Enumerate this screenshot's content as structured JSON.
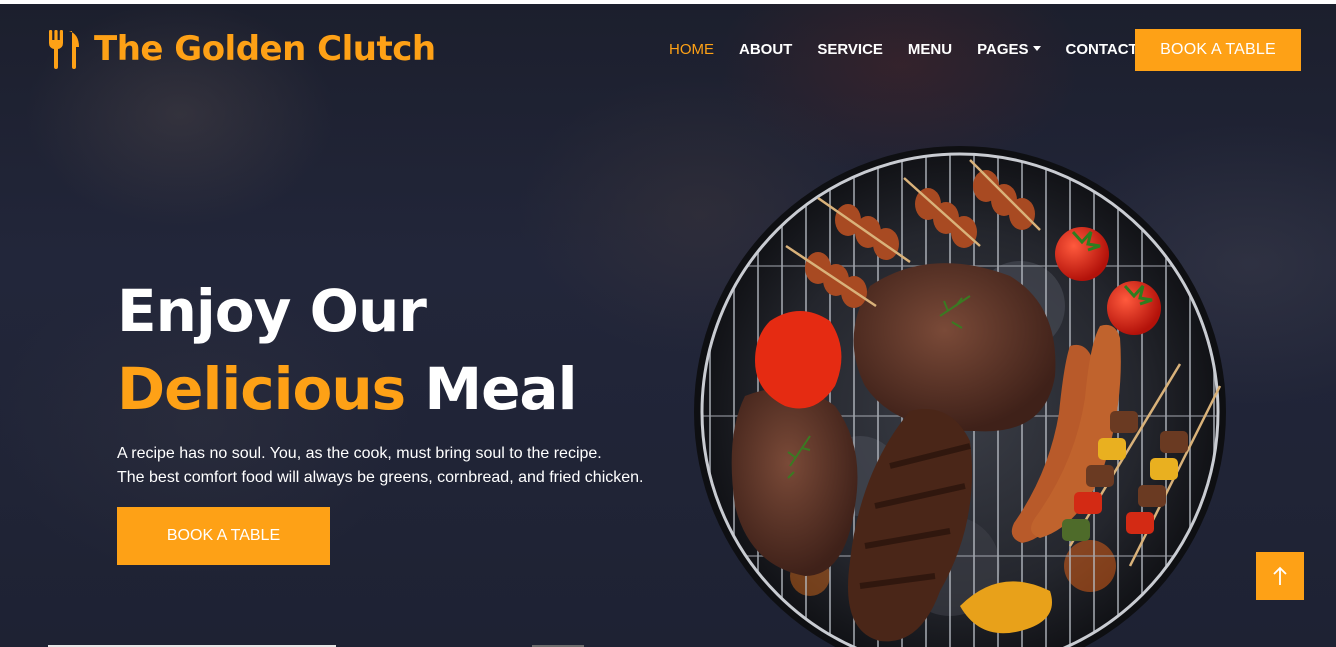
{
  "brand": {
    "name": "The Golden Clutch",
    "icon": "utensils-icon"
  },
  "nav": {
    "items": [
      {
        "label": "HOME",
        "active": true
      },
      {
        "label": "ABOUT",
        "active": false
      },
      {
        "label": "SERVICE",
        "active": false
      },
      {
        "label": "MENU",
        "active": false
      },
      {
        "label": "PAGES",
        "active": false,
        "dropdown": true
      },
      {
        "label": "CONTACT",
        "active": false
      }
    ],
    "cta_label": "BOOK A TABLE"
  },
  "hero": {
    "title_line1": "Enjoy Our",
    "title_accent": "Delicious",
    "title_rest": "Meal",
    "text_line1": "A recipe has no soul. You, as the cook, must bring soul to the recipe.",
    "text_line2": "The best comfort food will always be greens, cornbread, and fried chicken.",
    "button_label": "BOOK A TABLE",
    "image": "bbq-grill-image"
  },
  "back_to_top": {
    "icon": "arrow-up-icon"
  },
  "colors": {
    "accent": "#FEA116",
    "dark": "#1c1f2d",
    "text": "#ffffff"
  }
}
